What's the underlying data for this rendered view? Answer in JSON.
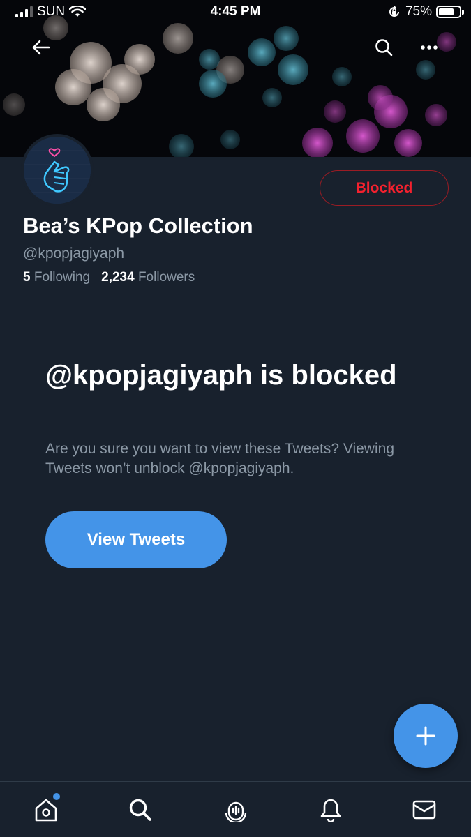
{
  "status_bar": {
    "carrier": "SUN",
    "time": "4:45 PM",
    "battery": "75%",
    "battery_level": 0.75
  },
  "header": {
    "back_icon": "arrow-left-icon",
    "search_icon": "search-icon",
    "more_icon": "more-horizontal-icon"
  },
  "profile": {
    "name": "Bea’s KPop Collection",
    "handle": "@kpopjagiyaph",
    "following_count": "5",
    "following_label": "Following",
    "followers_count": "2,234",
    "followers_label": "Followers",
    "blocked_label": "Blocked"
  },
  "blocked_notice": {
    "title": "@kpopjagiyaph is blocked",
    "description": "Are you sure you want to view these Tweets? Viewing Tweets won’t unblock @kpopjagiyaph.",
    "view_button": "View Tweets"
  },
  "colors": {
    "background": "#18212d",
    "accent": "#4494e8",
    "blocked_red": "#f4212e",
    "secondary_text": "#8b98a5"
  },
  "tabbar": {
    "items": [
      "home-icon",
      "search-icon",
      "spaces-icon",
      "notifications-icon",
      "messages-icon"
    ]
  }
}
